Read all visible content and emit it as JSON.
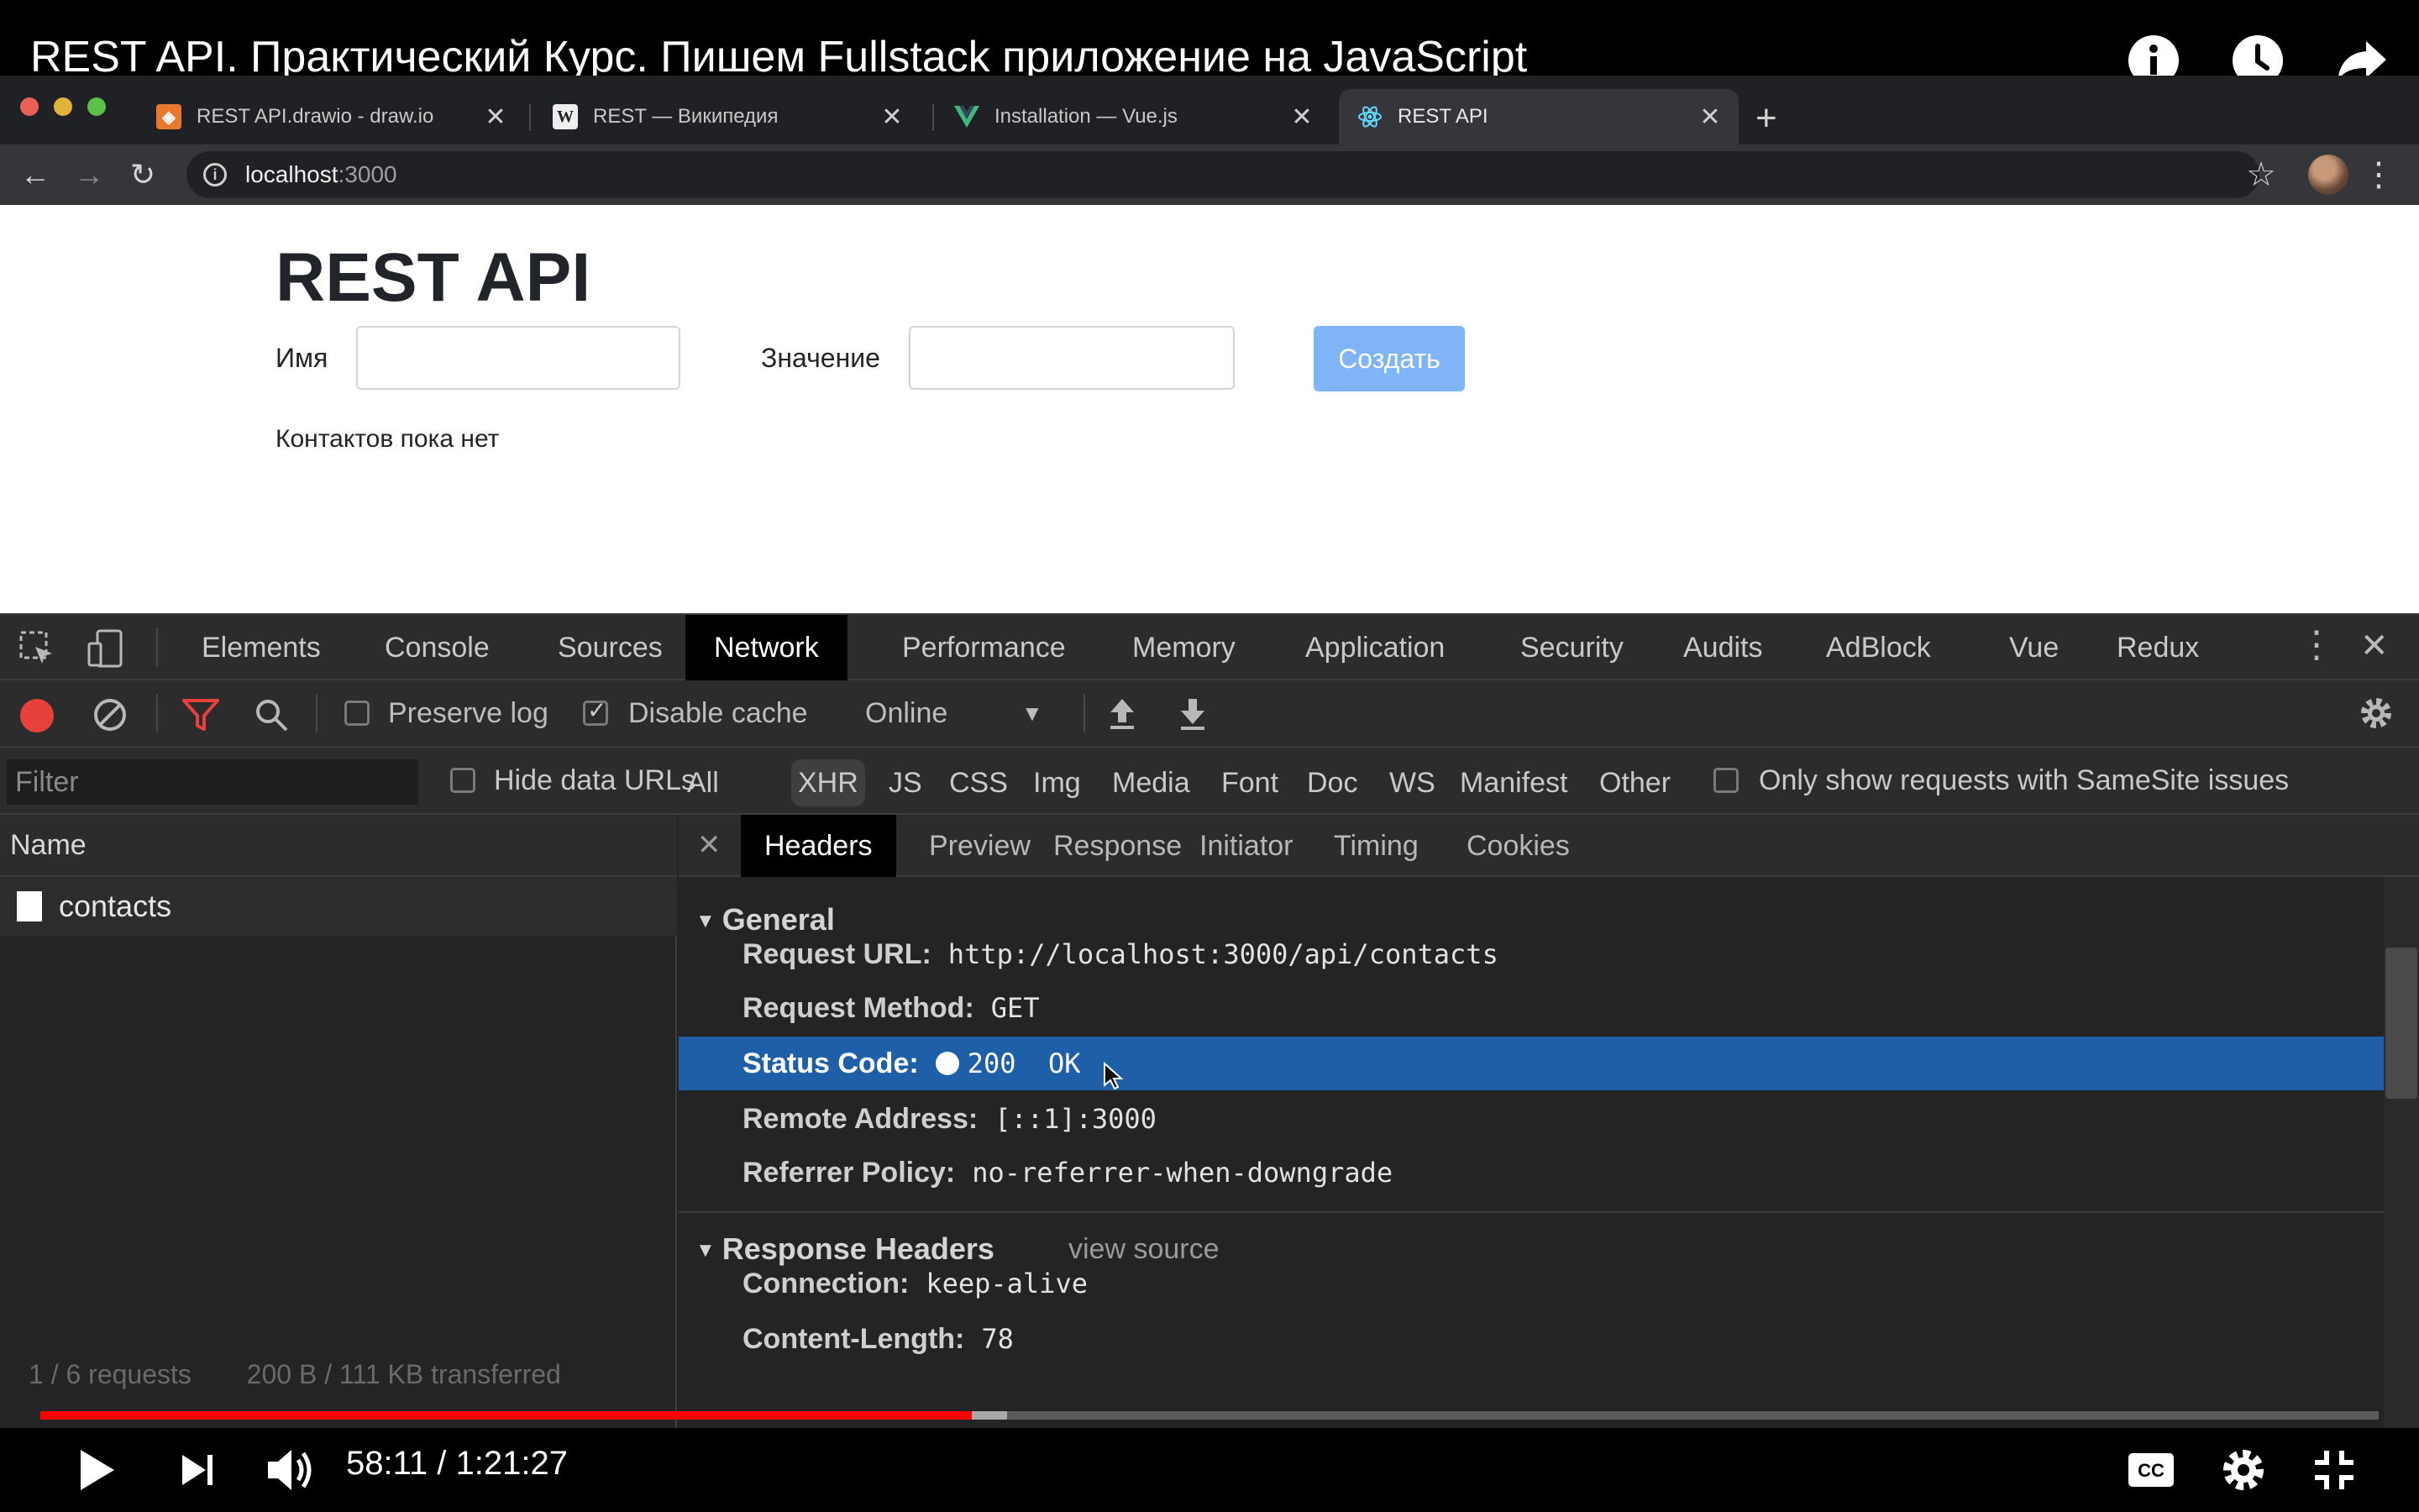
{
  "video": {
    "title": "REST API. Практический Курс. Пишем Fullstack приложение на JavaScript",
    "time_current": "58:11",
    "time_separator": "/",
    "time_total": "1:21:27",
    "progress": 0.3985,
    "buffered": 0.4135,
    "icons": [
      "info-icon",
      "watch-later-icon",
      "share-icon",
      "play-icon",
      "next-icon",
      "volume-icon",
      "captions-icon",
      "settings-icon",
      "exit-fullscreen-icon"
    ]
  },
  "browser": {
    "tabs": [
      {
        "label": "REST API.drawio - draw.io",
        "favicon": "drawio-icon",
        "active": false
      },
      {
        "label": "REST — Википедия",
        "favicon": "wikipedia-icon",
        "active": false
      },
      {
        "label": "Installation — Vue.js",
        "favicon": "vue-icon",
        "active": false
      },
      {
        "label": "REST API",
        "favicon": "react-icon",
        "active": true
      }
    ],
    "url_host": "localhost",
    "url_port": ":3000"
  },
  "page": {
    "heading": "REST API",
    "name_label": "Имя",
    "name_value": "",
    "value_label": "Значение",
    "value_value": "",
    "create_button": "Создать",
    "empty_message": "Контактов пока нет",
    "button_color": "#7fb4f6"
  },
  "devtools": {
    "tabs": [
      "Elements",
      "Console",
      "Sources",
      "Network",
      "Performance",
      "Memory",
      "Application",
      "Security",
      "Audits",
      "AdBlock",
      "Vue",
      "Redux"
    ],
    "active_tab": "Network",
    "toolbar": {
      "preserve_log": "Preserve log",
      "preserve_log_checked": false,
      "disable_cache": "Disable cache",
      "disable_cache_checked": true,
      "throttling": "Online"
    },
    "filter": {
      "placeholder": "Filter",
      "hide_data_urls": "Hide data URLs",
      "types": [
        "All",
        "XHR",
        "JS",
        "CSS",
        "Img",
        "Media",
        "Font",
        "Doc",
        "WS",
        "Manifest",
        "Other"
      ],
      "active_type": "XHR",
      "samesite": "Only show requests with SameSite issues"
    },
    "requests_header": "Name",
    "requests": [
      "contacts"
    ],
    "status_summary": "1 / 6 requests",
    "status_transfer": "200 B / 111 KB transferred",
    "detail_tabs": [
      "Headers",
      "Preview",
      "Response",
      "Initiator",
      "Timing",
      "Cookies"
    ],
    "active_detail_tab": "Headers",
    "general": {
      "title": "General",
      "rows": [
        {
          "key": "Request URL:",
          "value": "http://localhost:3000/api/contacts"
        },
        {
          "key": "Request Method:",
          "value": "GET"
        },
        {
          "key": "Status Code:",
          "value": "200  OK",
          "selected": true
        },
        {
          "key": "Remote Address:",
          "value": "[::1]:3000"
        },
        {
          "key": "Referrer Policy:",
          "value": "no-referrer-when-downgrade"
        }
      ]
    },
    "response_headers": {
      "title": "Response Headers",
      "view_source": "view source",
      "rows": [
        {
          "key": "Connection:",
          "value": "keep-alive"
        },
        {
          "key": "Content-Length:",
          "value": "78"
        }
      ]
    },
    "accent_color": "#1f5fa8",
    "record_color": "#e8413b"
  }
}
